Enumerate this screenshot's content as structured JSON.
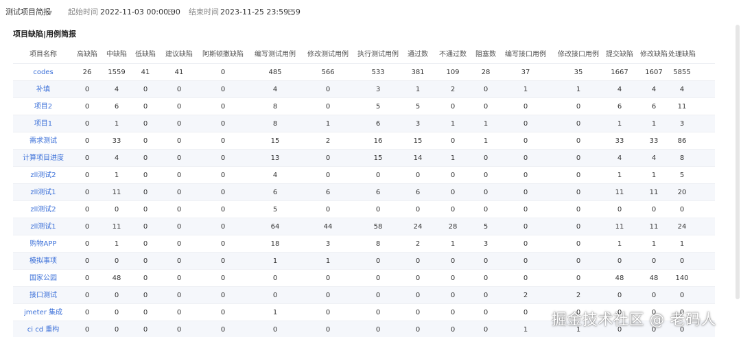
{
  "filters": {
    "project": "测试项目简报",
    "start_label": "起始时间",
    "start_value": "2022-11-03 00:00:00",
    "end_label": "结束时间",
    "end_value": "2023-11-25 23:59:59"
  },
  "section_title": "项目缺陷|用例简报",
  "table": {
    "columns": [
      "项目名称",
      "高缺陷",
      "中缺陷",
      "低缺陷",
      "建议缺陷",
      "阿斯顿撒缺陷",
      "编写测试用例",
      "修改测试用例",
      "执行测试用例",
      "通过数",
      "不通过数",
      "阻塞数",
      "编写接口用例",
      "修改接口用例",
      "提交缺陷",
      "修改缺陷",
      "处理缺陷"
    ],
    "rows": [
      [
        "codes",
        "26",
        "1559",
        "41",
        "41",
        "0",
        "485",
        "566",
        "533",
        "381",
        "109",
        "28",
        "37",
        "35",
        "1667",
        "1607",
        "5855"
      ],
      [
        "补填",
        "0",
        "4",
        "0",
        "0",
        "0",
        "4",
        "0",
        "3",
        "1",
        "2",
        "0",
        "1",
        "1",
        "4",
        "4",
        "4"
      ],
      [
        "项目2",
        "0",
        "6",
        "0",
        "0",
        "0",
        "8",
        "0",
        "5",
        "5",
        "0",
        "0",
        "0",
        "0",
        "6",
        "6",
        "11"
      ],
      [
        "项目1",
        "0",
        "1",
        "0",
        "0",
        "0",
        "8",
        "1",
        "6",
        "3",
        "1",
        "1",
        "0",
        "0",
        "1",
        "1",
        "3"
      ],
      [
        "需求测试",
        "0",
        "33",
        "0",
        "0",
        "0",
        "15",
        "2",
        "16",
        "15",
        "0",
        "1",
        "0",
        "0",
        "33",
        "33",
        "86"
      ],
      [
        "计算项目进度",
        "0",
        "4",
        "0",
        "0",
        "0",
        "13",
        "0",
        "15",
        "14",
        "1",
        "0",
        "0",
        "0",
        "4",
        "4",
        "8"
      ],
      [
        "zll测试2",
        "0",
        "1",
        "0",
        "0",
        "0",
        "4",
        "0",
        "0",
        "0",
        "0",
        "0",
        "0",
        "0",
        "1",
        "1",
        "5"
      ],
      [
        "zll测试1",
        "0",
        "11",
        "0",
        "0",
        "0",
        "6",
        "6",
        "6",
        "6",
        "0",
        "0",
        "0",
        "0",
        "11",
        "11",
        "20"
      ],
      [
        "zll测试2",
        "0",
        "0",
        "0",
        "0",
        "0",
        "5",
        "0",
        "0",
        "0",
        "0",
        "0",
        "0",
        "0",
        "0",
        "0",
        "0"
      ],
      [
        "zll测试1",
        "0",
        "11",
        "0",
        "0",
        "0",
        "64",
        "44",
        "58",
        "24",
        "28",
        "5",
        "0",
        "0",
        "11",
        "11",
        "24"
      ],
      [
        "购物APP",
        "0",
        "1",
        "0",
        "0",
        "0",
        "18",
        "3",
        "8",
        "2",
        "1",
        "3",
        "0",
        "0",
        "1",
        "1",
        "1"
      ],
      [
        "模拟事项",
        "0",
        "0",
        "0",
        "0",
        "0",
        "1",
        "1",
        "0",
        "0",
        "0",
        "0",
        "0",
        "0",
        "0",
        "0",
        "0"
      ],
      [
        "国家公园",
        "0",
        "48",
        "0",
        "0",
        "0",
        "0",
        "0",
        "0",
        "0",
        "0",
        "0",
        "0",
        "0",
        "48",
        "48",
        "140"
      ],
      [
        "接口测试",
        "0",
        "0",
        "0",
        "0",
        "0",
        "0",
        "0",
        "0",
        "0",
        "0",
        "0",
        "2",
        "2",
        "0",
        "0",
        "0"
      ],
      [
        "jmeter 集成",
        "0",
        "0",
        "0",
        "0",
        "0",
        "1",
        "0",
        "0",
        "0",
        "0",
        "0",
        "0",
        "0",
        "0",
        "0",
        "0"
      ],
      [
        "ci cd 重构",
        "0",
        "0",
        "0",
        "0",
        "0",
        "0",
        "0",
        "0",
        "0",
        "0",
        "0",
        "1",
        "1",
        "0",
        "0",
        "0"
      ]
    ]
  },
  "watermark": "掘金技术社区 @ 老码人"
}
